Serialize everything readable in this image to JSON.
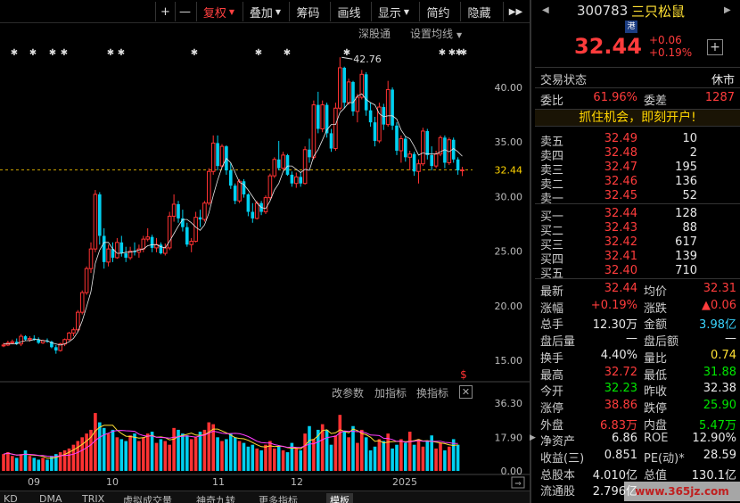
{
  "toolbar": {
    "buttons": [
      "+",
      "—",
      "复权",
      "叠加",
      "筹码",
      "画线",
      "显示",
      "简约",
      "隐藏",
      "▶▶"
    ],
    "active": "复权"
  },
  "toolbar2": {
    "sgt": "深股通",
    "ma": "设置均线"
  },
  "chart_data": [
    {
      "type": "candlestick",
      "title": "",
      "ylim": [
        14,
        44
      ],
      "y_ticks": [
        "40.00",
        "35.00",
        "30.00",
        "25.00",
        "20.00",
        "15.00"
      ],
      "x_labels": [
        "09",
        "10",
        "11",
        "12",
        "2025"
      ],
      "last_price": "32.44",
      "high_annotation": "42.76",
      "candles": [
        [
          16.4,
          16.6,
          16.2,
          16.4
        ],
        [
          16.4,
          16.8,
          16.3,
          16.6
        ],
        [
          16.6,
          16.9,
          16.5,
          16.7
        ],
        [
          16.7,
          17.0,
          16.4,
          16.5
        ],
        [
          16.5,
          17.4,
          16.3,
          17.2
        ],
        [
          17.2,
          17.3,
          16.8,
          16.9
        ],
        [
          16.9,
          17.2,
          16.7,
          17.0
        ],
        [
          17.0,
          17.3,
          16.8,
          16.9
        ],
        [
          16.9,
          17.1,
          16.5,
          16.6
        ],
        [
          16.6,
          16.9,
          16.5,
          16.8
        ],
        [
          16.8,
          17.0,
          16.6,
          16.7
        ],
        [
          16.7,
          16.8,
          16.1,
          16.2
        ],
        [
          16.2,
          16.4,
          15.6,
          15.9
        ],
        [
          15.9,
          16.6,
          15.8,
          16.5
        ],
        [
          16.5,
          17.0,
          16.3,
          16.9
        ],
        [
          16.9,
          17.6,
          16.8,
          17.5
        ],
        [
          17.5,
          18.0,
          17.2,
          17.8
        ],
        [
          17.8,
          19.6,
          17.6,
          19.4
        ],
        [
          19.4,
          21.4,
          19.2,
          21.2
        ],
        [
          21.2,
          23.6,
          21.0,
          23.4
        ],
        [
          23.4,
          25.8,
          23.0,
          25.2
        ],
        [
          25.2,
          30.6,
          24.9,
          30.2
        ],
        [
          30.2,
          30.4,
          25.6,
          26.4
        ],
        [
          26.4,
          27.1,
          23.4,
          24.0
        ],
        [
          24.0,
          25.6,
          23.6,
          25.2
        ],
        [
          25.2,
          25.8,
          24.0,
          24.4
        ],
        [
          24.4,
          26.2,
          24.3,
          25.8
        ],
        [
          25.8,
          26.4,
          24.5,
          24.8
        ],
        [
          24.8,
          25.4,
          24.0,
          24.4
        ],
        [
          24.4,
          25.4,
          24.2,
          25.0
        ],
        [
          25.0,
          25.8,
          24.6,
          24.9
        ],
        [
          24.9,
          25.6,
          24.4,
          25.2
        ],
        [
          25.2,
          26.4,
          24.9,
          26.1
        ],
        [
          26.1,
          27.1,
          25.9,
          26.3
        ],
        [
          26.3,
          26.5,
          24.9,
          25.3
        ],
        [
          25.3,
          26.2,
          24.9,
          25.6
        ],
        [
          25.6,
          25.8,
          24.7,
          24.8
        ],
        [
          24.8,
          25.7,
          24.6,
          25.3
        ],
        [
          25.3,
          28.6,
          25.1,
          28.2
        ],
        [
          28.2,
          30.2,
          27.7,
          29.3
        ],
        [
          29.3,
          29.6,
          27.6,
          28.0
        ],
        [
          28.0,
          28.8,
          26.8,
          27.2
        ],
        [
          27.2,
          27.6,
          25.4,
          25.6
        ],
        [
          25.6,
          26.2,
          24.9,
          25.9
        ],
        [
          25.9,
          28.6,
          25.8,
          28.1
        ],
        [
          28.1,
          28.8,
          27.2,
          27.9
        ],
        [
          27.9,
          29.6,
          27.7,
          29.4
        ],
        [
          29.4,
          32.6,
          29.2,
          32.3
        ],
        [
          32.3,
          35.6,
          32.0,
          34.9
        ],
        [
          34.9,
          35.6,
          32.4,
          32.8
        ],
        [
          32.8,
          34.8,
          32.6,
          34.6
        ],
        [
          34.6,
          34.7,
          32.0,
          32.4
        ],
        [
          32.4,
          33.1,
          30.7,
          31.0
        ],
        [
          31.0,
          31.2,
          29.3,
          29.6
        ],
        [
          29.6,
          31.6,
          29.4,
          31.4
        ],
        [
          31.4,
          31.6,
          29.9,
          30.2
        ],
        [
          30.2,
          30.3,
          28.2,
          28.6
        ],
        [
          28.6,
          29.4,
          27.6,
          28.0
        ],
        [
          28.0,
          29.6,
          27.9,
          29.4
        ],
        [
          29.4,
          29.6,
          28.3,
          28.6
        ],
        [
          28.6,
          30.1,
          28.4,
          29.9
        ],
        [
          29.9,
          32.1,
          29.7,
          31.9
        ],
        [
          31.9,
          33.6,
          31.7,
          33.4
        ],
        [
          33.4,
          35.1,
          32.4,
          32.6
        ],
        [
          32.6,
          34.1,
          32.4,
          33.8
        ],
        [
          33.8,
          33.9,
          31.9,
          32.0
        ],
        [
          32.0,
          32.3,
          30.9,
          31.2
        ],
        [
          31.2,
          32.2,
          30.8,
          31.8
        ],
        [
          31.8,
          32.2,
          30.9,
          31.2
        ],
        [
          31.2,
          34.6,
          31.1,
          34.3
        ],
        [
          34.3,
          35.3,
          33.1,
          33.6
        ],
        [
          33.6,
          38.8,
          33.4,
          38.4
        ],
        [
          38.4,
          39.6,
          35.8,
          36.2
        ],
        [
          36.2,
          38.8,
          35.9,
          38.4
        ],
        [
          38.4,
          38.6,
          35.4,
          35.8
        ],
        [
          35.8,
          36.2,
          34.1,
          34.4
        ],
        [
          34.4,
          38.6,
          34.2,
          38.1
        ],
        [
          38.1,
          42.76,
          37.9,
          41.8
        ],
        [
          41.8,
          41.9,
          38.1,
          38.6
        ],
        [
          38.6,
          40.8,
          38.4,
          40.5
        ],
        [
          40.5,
          40.6,
          37.4,
          37.8
        ],
        [
          37.8,
          39.4,
          36.8,
          39.1
        ],
        [
          39.1,
          41.6,
          38.9,
          41.2
        ],
        [
          41.2,
          41.4,
          37.4,
          37.9
        ],
        [
          37.9,
          38.6,
          36.4,
          36.8
        ],
        [
          36.8,
          37.3,
          34.6,
          35.1
        ],
        [
          35.1,
          38.6,
          34.9,
          38.2
        ],
        [
          38.2,
          38.5,
          36.1,
          36.6
        ],
        [
          36.6,
          40.6,
          36.4,
          39.8
        ],
        [
          39.8,
          40.0,
          36.1,
          36.5
        ],
        [
          36.5,
          36.8,
          33.8,
          34.2
        ],
        [
          34.2,
          35.6,
          33.1,
          35.3
        ],
        [
          35.3,
          35.5,
          33.2,
          33.6
        ],
        [
          33.6,
          34.2,
          32.4,
          33.9
        ],
        [
          33.9,
          34.1,
          31.9,
          32.3
        ],
        [
          32.3,
          33.4,
          31.2,
          33.0
        ],
        [
          33.0,
          36.3,
          32.8,
          36.0
        ],
        [
          36.0,
          36.2,
          33.4,
          33.8
        ],
        [
          33.8,
          34.6,
          32.4,
          32.8
        ],
        [
          32.8,
          34.2,
          32.6,
          33.9
        ],
        [
          33.9,
          35.6,
          33.7,
          35.4
        ],
        [
          35.4,
          35.6,
          32.6,
          33.1
        ],
        [
          33.1,
          35.4,
          32.9,
          35.2
        ],
        [
          35.2,
          35.4,
          33.1,
          33.4
        ],
        [
          33.4,
          33.6,
          32.0,
          32.4
        ],
        [
          32.4,
          32.72,
          31.88,
          32.44
        ]
      ],
      "ma5": [
        16.5,
        16.5,
        16.5,
        16.5,
        16.7,
        16.8,
        16.8,
        16.9,
        16.9,
        16.8,
        16.8,
        16.6,
        16.5,
        16.4,
        16.5,
        16.7,
        17.0,
        17.6,
        18.6,
        19.9,
        21.3,
        23.9,
        25.1,
        25.8,
        25.8,
        25.2,
        24.8,
        24.8,
        24.9,
        24.9,
        25.0,
        25.1,
        25.2,
        25.5,
        25.6,
        25.6,
        25.4,
        25.3,
        25.9,
        26.6,
        27.3,
        27.9,
        27.9,
        27.6,
        27.2,
        26.9,
        27.4,
        28.5,
        30.1,
        31.5,
        32.7,
        33.5,
        33.1,
        32.2,
        31.3,
        31.1,
        30.6,
        30.0,
        29.4,
        29.0,
        28.9,
        29.6,
        30.6,
        31.2,
        32.3,
        32.8,
        32.8,
        32.5,
        32.2,
        32.5,
        32.4,
        33.7,
        34.3,
        35.2,
        36.1,
        36.6,
        36.6,
        37.7,
        38.1,
        38.6,
        38.6,
        39.2,
        39.4,
        38.9,
        38.6,
        38.4,
        37.6,
        37.3,
        37.4,
        37.4,
        37.1,
        36.1,
        35.5,
        35.3,
        34.6,
        33.8,
        34.0,
        33.9,
        33.9,
        33.9,
        34.1,
        34.3,
        34.1,
        34.4,
        34.1,
        33.7
      ],
      "volume_ylim": [
        0,
        36.3
      ],
      "volume_ticks": [
        "36.30",
        "17.90",
        "0.00"
      ],
      "volumes": [
        9,
        10,
        8,
        7,
        9,
        11,
        8,
        7,
        6,
        7,
        6,
        8,
        9,
        10,
        11,
        12,
        14,
        16,
        18,
        20,
        22,
        31,
        26,
        23,
        20,
        22,
        18,
        17,
        16,
        19,
        20,
        16,
        18,
        20,
        21,
        15,
        17,
        16,
        14,
        23,
        22,
        20,
        19,
        17,
        18,
        21,
        22,
        26,
        25,
        18,
        16,
        17,
        20,
        18,
        16,
        15,
        13,
        14,
        12,
        11,
        14,
        16,
        12,
        13,
        11,
        10,
        15,
        12,
        11,
        20,
        24,
        17,
        22,
        25,
        22,
        14,
        19,
        30,
        21,
        18,
        24,
        15,
        22,
        18,
        11,
        13,
        17,
        16,
        20,
        12,
        14,
        17,
        15,
        21,
        14,
        17,
        13,
        16,
        19,
        12,
        15,
        11,
        13,
        17,
        14
      ]
    }
  ],
  "volume_bar": {
    "items": [
      "改参数",
      "加指标",
      "换指标"
    ],
    "close": "✕"
  },
  "bottom_tabs": [
    "KD",
    "DMA",
    "TRIX",
    "虚拟成交量",
    "神奇九转",
    "更多指标",
    "模板"
  ],
  "bottom_tab_selected": "模板",
  "stock": {
    "code": "300783",
    "name": "三只松鼠",
    "badge": "港",
    "price": "32.44",
    "change": "+0.06",
    "change_pct": "+0.19%",
    "add_icon": "+"
  },
  "status": {
    "label": "交易状态",
    "value": "休市"
  },
  "ratio": {
    "label1": "委比",
    "value1": "61.96%",
    "label2": "委差",
    "value2": "1287"
  },
  "promo": "抓住机会，即刻开户!",
  "sell": [
    {
      "label": "卖五",
      "price": "32.49",
      "vol": "10"
    },
    {
      "label": "卖四",
      "price": "32.48",
      "vol": "2"
    },
    {
      "label": "卖三",
      "price": "32.47",
      "vol": "195"
    },
    {
      "label": "卖二",
      "price": "32.46",
      "vol": "136"
    },
    {
      "label": "卖一",
      "price": "32.45",
      "vol": "52"
    }
  ],
  "buy": [
    {
      "label": "买一",
      "price": "32.44",
      "vol": "128"
    },
    {
      "label": "买二",
      "price": "32.43",
      "vol": "88"
    },
    {
      "label": "买三",
      "price": "32.42",
      "vol": "617"
    },
    {
      "label": "买四",
      "price": "32.41",
      "vol": "139"
    },
    {
      "label": "买五",
      "price": "32.40",
      "vol": "710"
    }
  ],
  "stats": [
    {
      "l1": "最新",
      "v1": "32.44",
      "c1": "red",
      "l2": "均价",
      "v2": "32.31",
      "c2": "red"
    },
    {
      "l1": "涨幅",
      "v1": "+0.19%",
      "c1": "red",
      "l2": "涨跌",
      "v2": "▲0.06",
      "c2": "red"
    },
    {
      "l1": "总手",
      "v1": "12.30万",
      "c1": "white",
      "l2": "金额",
      "v2": "3.98亿",
      "c2": "cyan"
    },
    {
      "l1": "盘后量",
      "v1": "—",
      "c1": "white",
      "l2": "盘后额",
      "v2": "—",
      "c2": "white"
    },
    {
      "l1": "换手",
      "v1": "4.40%",
      "c1": "white",
      "l2": "量比",
      "v2": "0.74",
      "c2": "yellow"
    },
    {
      "l1": "最高",
      "v1": "32.72",
      "c1": "red",
      "l2": "最低",
      "v2": "31.88",
      "c2": "green"
    },
    {
      "l1": "今开",
      "v1": "32.23",
      "c1": "green",
      "l2": "昨收",
      "v2": "32.38",
      "c2": "white"
    },
    {
      "l1": "涨停",
      "v1": "38.86",
      "c1": "red",
      "l2": "跌停",
      "v2": "25.90",
      "c2": "green"
    },
    {
      "l1": "外盘",
      "v1": "6.83万",
      "c1": "red",
      "l2": "内盘",
      "v2": "5.47万",
      "c2": "green"
    },
    {
      "l1": "净资产",
      "v1": "6.86",
      "c1": "white",
      "l2": "ROE",
      "v2": "12.90%",
      "c2": "white"
    },
    {
      "l1": "收益(三)",
      "v1": "0.851",
      "c1": "white",
      "l2": "PE(动)*",
      "v2": "28.59",
      "c2": "white"
    },
    {
      "l1": "总股本",
      "v1": "4.010亿",
      "c1": "white",
      "l2": "总值",
      "v2": "130.1亿",
      "c2": "white"
    },
    {
      "l1": "流通股",
      "v1": "2.796亿",
      "c1": "white",
      "l2": "",
      "v2": "",
      "c2": "white"
    }
  ],
  "watermark": "www.365jz.com"
}
